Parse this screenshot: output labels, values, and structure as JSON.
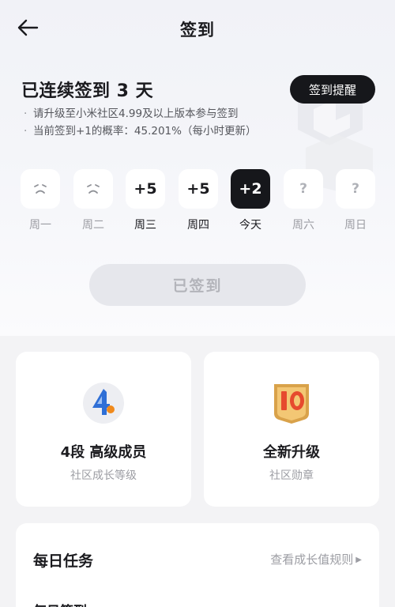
{
  "header": {
    "title": "签到",
    "back_icon": "arrow-left-icon"
  },
  "streak": {
    "title": "已连续签到 3 天",
    "remind_button": "签到提醒",
    "notes": [
      "请升级至小米社区4.99及以上版本参与签到",
      "当前签到+1的概率：45.201%（每小时更新）"
    ]
  },
  "week": [
    {
      "label": "周一",
      "value": "",
      "state": "missed",
      "icon": "frown-face-icon"
    },
    {
      "label": "周二",
      "value": "",
      "state": "missed",
      "icon": "frown-face-icon"
    },
    {
      "label": "周三",
      "value": "+5",
      "state": "signed"
    },
    {
      "label": "周四",
      "value": "+5",
      "state": "signed"
    },
    {
      "label": "今天",
      "value": "+2",
      "state": "today"
    },
    {
      "label": "周六",
      "value": "?",
      "state": "future"
    },
    {
      "label": "周日",
      "value": "?",
      "state": "future"
    }
  ],
  "signed_button": "已签到",
  "cards": {
    "level": {
      "title": "4段 高级成员",
      "subtitle": "社区成长等级",
      "icon": "level-4-icon"
    },
    "badge": {
      "title": "全新升级",
      "subtitle": "社区勋章",
      "icon": "medal-10-icon"
    }
  },
  "tasks": {
    "title": "每日任务",
    "link": "查看成长值规则",
    "first_item": "每日签到"
  },
  "colors": {
    "dark": "#16171b",
    "accent_orange": "#f08a1c",
    "level_blue": "#2f6fd6"
  }
}
